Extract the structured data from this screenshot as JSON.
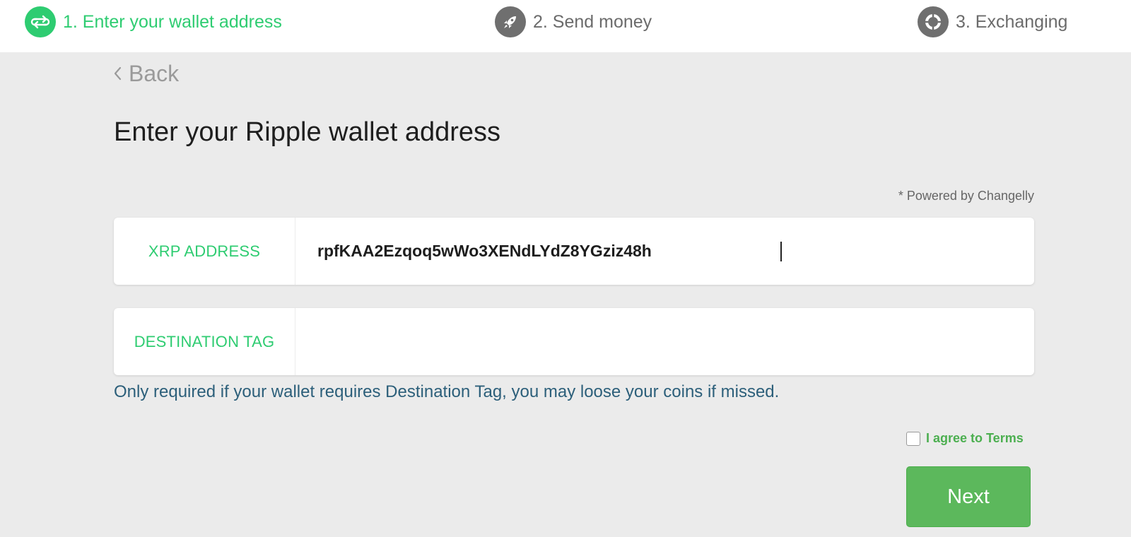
{
  "steps": [
    {
      "label": "1. Enter your wallet address",
      "icon": "exchange-arrows-icon",
      "state": "active"
    },
    {
      "label": "2. Send money",
      "icon": "rocket-icon",
      "state": "inactive"
    },
    {
      "label": "3. Exchanging",
      "icon": "loading-ring-icon",
      "state": "inactive"
    }
  ],
  "back_label": "Back",
  "title": "Enter your Ripple wallet address",
  "powered_by": "* Powered by Changelly",
  "fields": {
    "address": {
      "label": "XRP ADDRESS",
      "value": "rpfKAA2Ezqoq5wWo3XENdLYdZ8YGziz48h"
    },
    "destination_tag": {
      "label": "DESTINATION TAG",
      "value": ""
    }
  },
  "hint": "Only required if your wallet requires Destination Tag, you may loose your coins if missed.",
  "terms": {
    "label": "I agree to Terms",
    "checked": false
  },
  "next_label": "Next",
  "colors": {
    "accent": "#2ecc71",
    "button": "#5cb85c",
    "hint": "#2c5f7a",
    "background": "#ebebeb"
  }
}
